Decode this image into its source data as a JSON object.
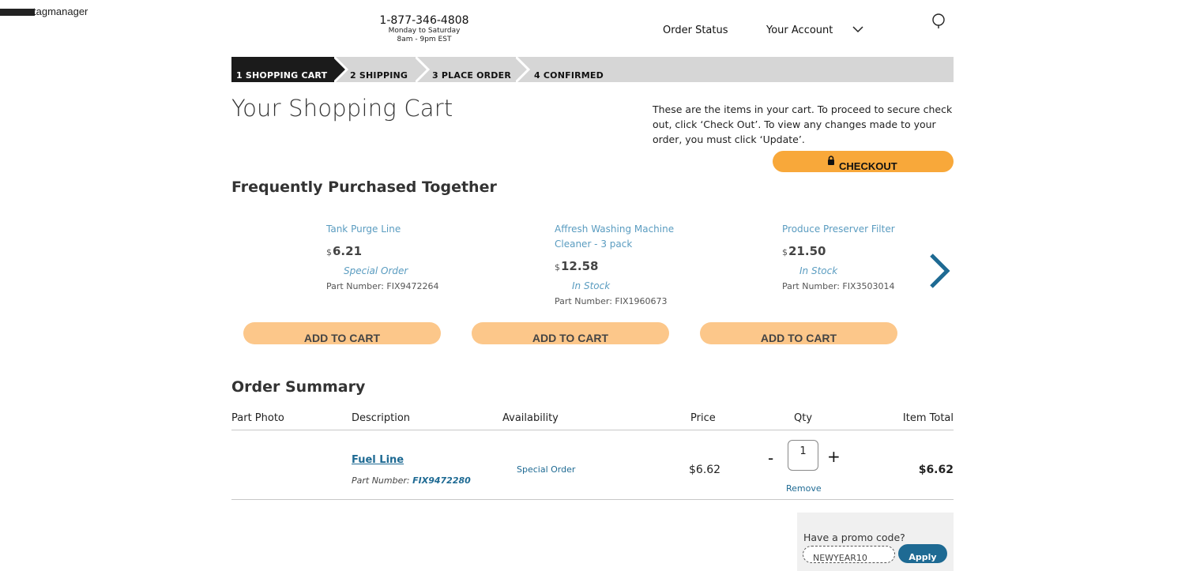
{
  "header": {
    "gtm_text": "tagmanager",
    "phone": "1-877-346-4808",
    "hours_days": "Monday to Saturday",
    "hours_time": "8am - 9pm EST",
    "order_status": "Order Status",
    "your_account": "Your Account"
  },
  "steps": [
    {
      "label": "1  SHOPPING CART",
      "active": true
    },
    {
      "label": "2  SHIPPING",
      "active": false
    },
    {
      "label": "3  PLACE ORDER",
      "active": false
    },
    {
      "label": "4  CONFIRMED",
      "active": false
    }
  ],
  "cart": {
    "title": "Your Shopping Cart",
    "intro": "These are the items in your cart. To proceed to secure check out, click ‘Check Out’. To view any changes made to your order, you must click ‘Update’.",
    "checkout_label": "CHECKOUT"
  },
  "fpt": {
    "title": "Frequently Purchased Together",
    "currency": "$",
    "part_number_label": "Part Number: ",
    "add_label": "ADD TO CART",
    "products": [
      {
        "name": "Tank Purge Line",
        "price": "6.21",
        "availability": "Special Order",
        "part_number": "FIX9472264"
      },
      {
        "name": "Affresh Washing Machine Cleaner - 3 pack",
        "price": "12.58",
        "availability": "In Stock",
        "part_number": "FIX1960673"
      },
      {
        "name": "Produce Preserver Filter",
        "price": "21.50",
        "availability": "In Stock",
        "part_number": "FIX3503014"
      }
    ]
  },
  "summary": {
    "title": "Order Summary",
    "columns": {
      "photo": "Part Photo",
      "description": "Description",
      "availability": "Availability",
      "price": "Price",
      "qty": "Qty",
      "total": "Item Total"
    },
    "item": {
      "name": "Fuel Line",
      "part_number_label": "Part Number: ",
      "part_number": "FIX9472280",
      "availability": "Special Order",
      "price": "$6.62",
      "qty": "1",
      "minus": "-",
      "plus": "+",
      "remove": "Remove",
      "total": "$6.62"
    }
  },
  "promo": {
    "question": "Have a promo code?",
    "value": "NEWYEAR10",
    "apply_label": "Apply"
  },
  "colors": {
    "checkout": "#f8a83a",
    "add_to_cart": "#fcc78a",
    "link_blue": "#1e6a93",
    "product_blue": "#5a9cc0",
    "step_active": "#1b1b1b",
    "step_bar": "#d6d6d6"
  }
}
